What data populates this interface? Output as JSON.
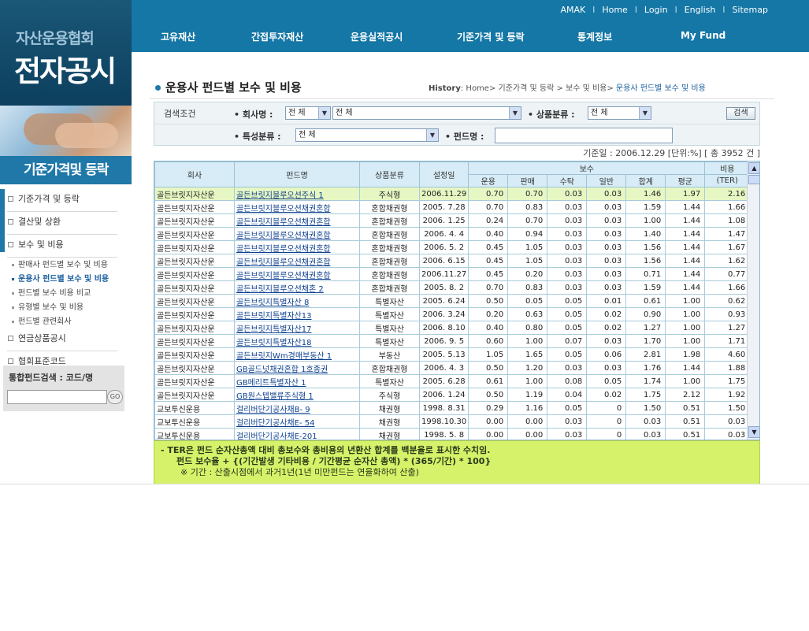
{
  "logo": {
    "line1": "자산운용협회",
    "line2": "전자공시"
  },
  "toplinks": [
    "AMAK",
    "Home",
    "Login",
    "English",
    "Sitemap"
  ],
  "nav": [
    "고유재산",
    "간접투자재산",
    "운용실적공시",
    "기준가격 및 등락",
    "통계정보",
    "My Fund"
  ],
  "section_title": "기준가격및 등락",
  "sidebar": {
    "items": [
      {
        "label": "기준가격 및 등락",
        "type": "item"
      },
      {
        "label": "결산및 상환",
        "type": "item"
      },
      {
        "label": "보수 및 비용",
        "type": "item"
      },
      {
        "label": "판매사 펀드별 보수 및 비용",
        "type": "sub"
      },
      {
        "label": "운용사 펀드별 보수 및 비용",
        "type": "sub-active"
      },
      {
        "label": "펀드별 보수 비용 비교",
        "type": "sub"
      },
      {
        "label": "유형별 보수 및 비용",
        "type": "sub"
      },
      {
        "label": "펀드별 관련회사",
        "type": "sub"
      },
      {
        "label": "연금상품공시",
        "type": "item"
      },
      {
        "label": "협회표준코드",
        "type": "item"
      }
    ]
  },
  "fund_search": {
    "title": "통합펀드검색 : 코드/명",
    "go": "GO"
  },
  "page_title": "운용사 펀드별 보수 및 비용",
  "breadcrumb": {
    "label": "History",
    "path": "Home> 기준가격 및 등락 > 보수 및 비용> ",
    "current": "운용사 펀드별 보수 및 비용"
  },
  "search": {
    "condition_label": "검색조건",
    "company_label": "• 회사명 :",
    "company_value1": "전 체",
    "company_value2": "전 체",
    "product_label": "• 상품분류 :",
    "product_value": "전 체",
    "feature_label": "• 특성분류 :",
    "feature_value": "전 체",
    "fund_label": "• 펀드명 :",
    "button": "검색"
  },
  "info": "기준일 : 2006.12.29 [단위:%] [ 총 3952 건 ]",
  "table": {
    "headers": {
      "company": "회사",
      "fund": "펀드명",
      "product": "상품분류",
      "date": "설정일",
      "fee": "보수",
      "cost": "비용",
      "ter": "(TER)",
      "sub": [
        "운용",
        "판매",
        "수탁",
        "일반",
        "합계",
        "평균"
      ]
    },
    "rows": [
      [
        "골든브릿지자산운",
        "골든브릿지블루오션주식 1",
        "주식형",
        "2006.11.29",
        "0.70",
        "0.70",
        "0.03",
        "0.03",
        "1.46",
        "1.97",
        "2.16"
      ],
      [
        "골든브릿지자산운",
        "골든브릿지블루오션채권혼합",
        "혼합채권형",
        "2005. 7.28",
        "0.70",
        "0.83",
        "0.03",
        "0.03",
        "1.59",
        "1.44",
        "1.66"
      ],
      [
        "골든브릿지자산운",
        "골든브릿지블루오션채권혼합",
        "혼합채권형",
        "2006. 1.25",
        "0.24",
        "0.70",
        "0.03",
        "0.03",
        "1.00",
        "1.44",
        "1.08"
      ],
      [
        "골든브릿지자산운",
        "골든브릿지블루오션채권혼합",
        "혼합채권형",
        "2006. 4. 4",
        "0.40",
        "0.94",
        "0.03",
        "0.03",
        "1.40",
        "1.44",
        "1.47"
      ],
      [
        "골든브릿지자산운",
        "골든브릿지블루오션채권혼합",
        "혼합채권형",
        "2006. 5. 2",
        "0.45",
        "1.05",
        "0.03",
        "0.03",
        "1.56",
        "1.44",
        "1.67"
      ],
      [
        "골든브릿지자산운",
        "골든브릿지블루오션채권혼합",
        "혼합채권형",
        "2006. 6.15",
        "0.45",
        "1.05",
        "0.03",
        "0.03",
        "1.56",
        "1.44",
        "1.62"
      ],
      [
        "골든브릿지자산운",
        "골든브릿지블루오션채권혼합",
        "혼합채권형",
        "2006.11.27",
        "0.45",
        "0.20",
        "0.03",
        "0.03",
        "0.71",
        "1.44",
        "0.77"
      ],
      [
        "골든브릿지자산운",
        "골든브릿지블루오션채혼 2",
        "혼합채권형",
        "2005. 8. 2",
        "0.70",
        "0.83",
        "0.03",
        "0.03",
        "1.59",
        "1.44",
        "1.66"
      ],
      [
        "골든브릿지자산운",
        "골든브릿지특별자산 8",
        "특별자산",
        "2005. 6.24",
        "0.50",
        "0.05",
        "0.05",
        "0.01",
        "0.61",
        "1.00",
        "0.62"
      ],
      [
        "골든브릿지자산운",
        "골든브릿지특별자산13",
        "특별자산",
        "2006. 3.24",
        "0.20",
        "0.63",
        "0.05",
        "0.02",
        "0.90",
        "1.00",
        "0.93"
      ],
      [
        "골든브릿지자산운",
        "골든브릿지특별자산17",
        "특별자산",
        "2006. 8.10",
        "0.40",
        "0.80",
        "0.05",
        "0.02",
        "1.27",
        "1.00",
        "1.27"
      ],
      [
        "골든브릿지자산운",
        "골든브릿지특별자산18",
        "특별자산",
        "2006. 9. 5",
        "0.60",
        "1.00",
        "0.07",
        "0.03",
        "1.70",
        "1.00",
        "1.71"
      ],
      [
        "골든브릿지자산운",
        "골든브릿지Wm경매부동산 1",
        "부동산",
        "2005. 5.13",
        "1.05",
        "1.65",
        "0.05",
        "0.06",
        "2.81",
        "1.98",
        "4.60"
      ],
      [
        "골든브릿지자산운",
        "GB골드넛채권혼합 1호종권",
        "혼합채권형",
        "2006. 4. 3",
        "0.50",
        "1.20",
        "0.03",
        "0.03",
        "1.76",
        "1.44",
        "1.88"
      ],
      [
        "골든브릿지자산운",
        "GB메리트특별자산 1",
        "특별자산",
        "2005. 6.28",
        "0.61",
        "1.00",
        "0.08",
        "0.05",
        "1.74",
        "1.00",
        "1.75"
      ],
      [
        "골든브릿지자산운",
        "GB원스텝밸류주식형 1",
        "주식형",
        "2006. 1.24",
        "0.50",
        "1.19",
        "0.04",
        "0.02",
        "1.75",
        "2.12",
        "1.92"
      ],
      [
        "교보투신운용",
        "걸리버단기공사채B- 9",
        "채권형",
        "1998. 8.31",
        "0.29",
        "1.16",
        "0.05",
        "0",
        "1.50",
        "0.51",
        "1.50"
      ],
      [
        "교보투신운용",
        "걸리버단기공사채E- 54",
        "채권형",
        "1998.10.30",
        "0.00",
        "0.00",
        "0.03",
        "0",
        "0.03",
        "0.51",
        "0.03"
      ],
      [
        "교보투신운용",
        "걸리버단기공사채E-201",
        "채권형",
        "1998. 5. 8",
        "0.00",
        "0.00",
        "0.03",
        "0",
        "0.03",
        "0.51",
        "0.03"
      ]
    ]
  },
  "note": {
    "line1": "- TER은 펀드 순자산총액 대비 총보수와 총비용의 년환산 합계를 백분율로 표시한 수치임.",
    "line2": "펀드 보수율 + {(기간발생 기타비용 / 기간평균 순자산 총액) * (365/기간) * 100}",
    "line3": "※ 기간 : 산출시점에서 과거1년(1년 미만펀드는 연율화하여 산출)"
  }
}
